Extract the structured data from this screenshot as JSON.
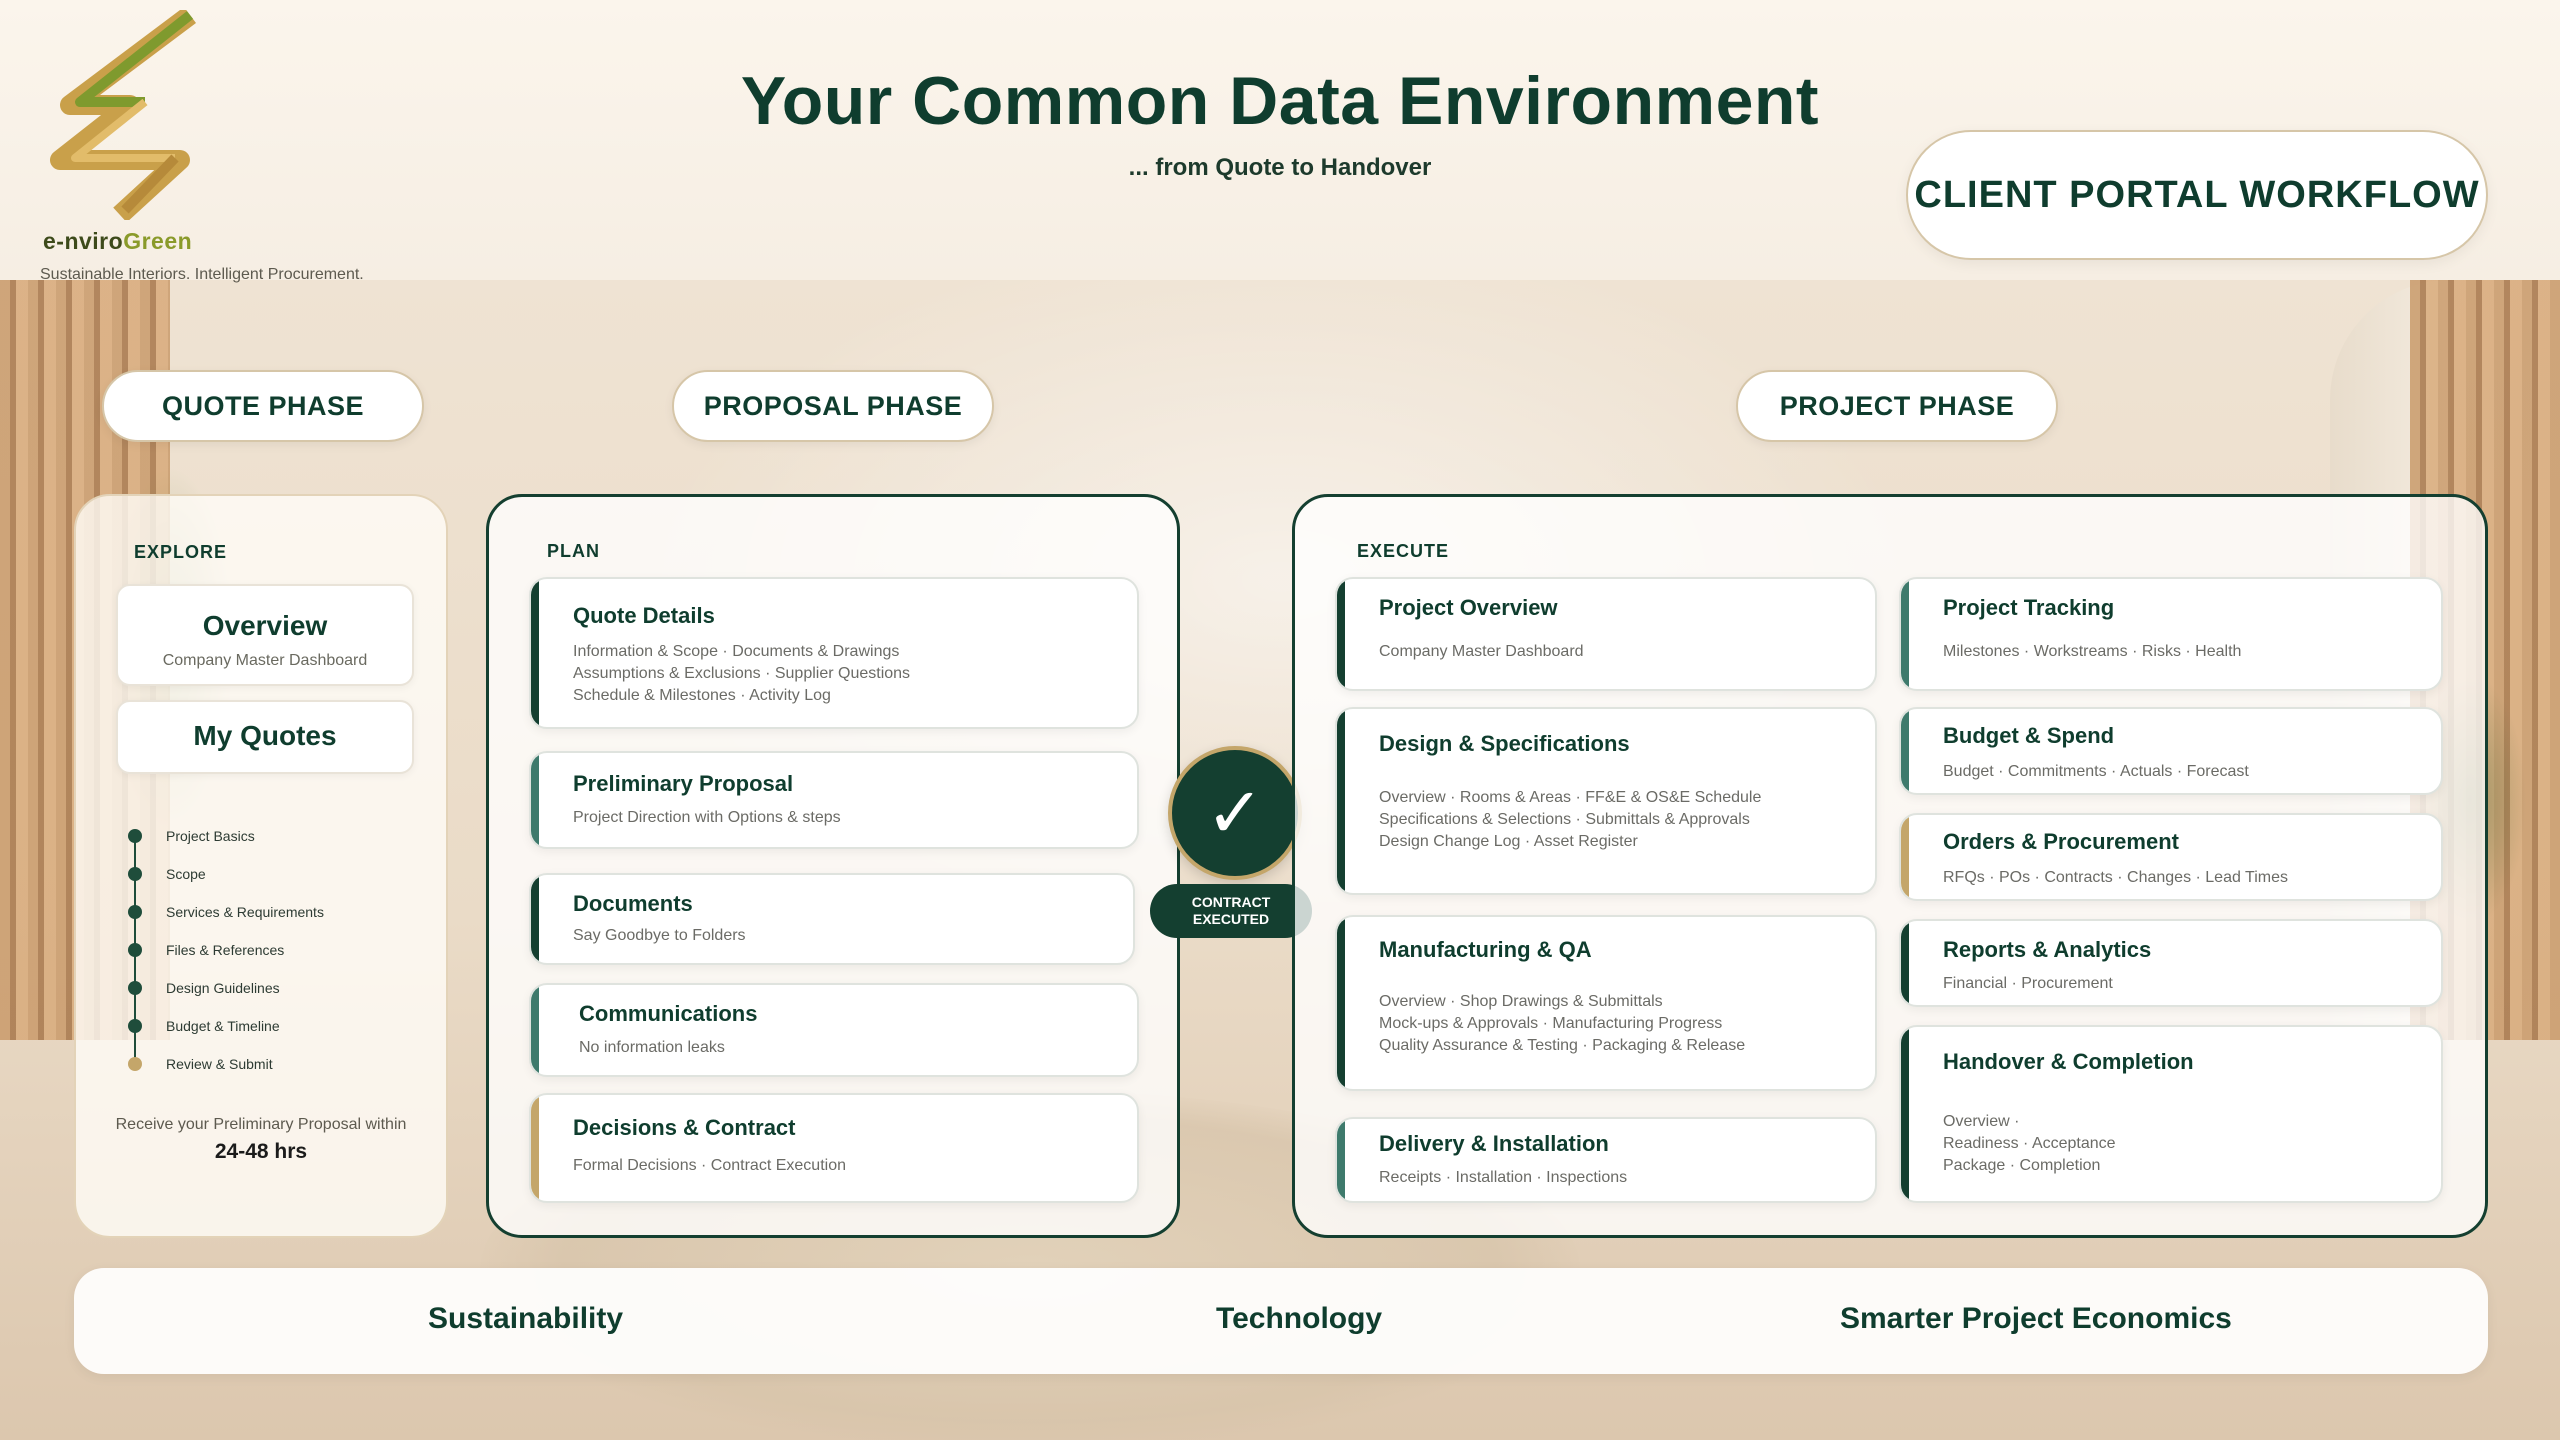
{
  "brand": {
    "name_part1": "e-nviro",
    "name_part2": "Green",
    "tagline": "Sustainable Interiors. Intelligent Procurement.",
    "logo_icon": "ribbon-z-logo-icon"
  },
  "header": {
    "title": "Your Common Data Environment",
    "subtitle": "... from Quote to Handover",
    "portal_button": "CLIENT PORTAL WORKFLOW"
  },
  "phases": {
    "quote": "QUOTE PHASE",
    "proposal": "PROPOSAL PHASE",
    "project": "PROJECT PHASE"
  },
  "explore": {
    "label": "EXPLORE",
    "overview_title": "Overview",
    "overview_sub": "Company Master Dashboard",
    "my_quotes": "My Quotes",
    "steps": [
      "Project Basics",
      "Scope",
      "Services & Requirements",
      "Files & References",
      "Design Guidelines",
      "Budget & Timeline",
      "Review & Submit"
    ],
    "receive_text": "Receive your Preliminary Proposal within",
    "receive_hrs": "24-48 hrs"
  },
  "plan": {
    "label": "PLAN",
    "cards": [
      {
        "title": "Quote Details",
        "desc": "Information & Scope  ·  Documents & Drawings\nAssumptions & Exclusions  ·  Supplier Questions\nSchedule & Milestones  ·  Activity Log"
      },
      {
        "title": "Preliminary Proposal",
        "desc": "Project Direction with Options & steps"
      },
      {
        "title": "Documents",
        "desc": "Say Goodbye to Folders"
      },
      {
        "title": "Communications",
        "desc": "No information leaks"
      },
      {
        "title": "Decisions & Contract",
        "desc": "Formal Decisions  ·  Contract Execution"
      }
    ]
  },
  "contract": {
    "check": "✓",
    "label": "CONTRACT\nEXECUTED"
  },
  "execute": {
    "label": "EXECUTE",
    "left_cards": [
      {
        "title": "Project Overview",
        "desc": "Company Master Dashboard"
      },
      {
        "title": "Design & Specifications",
        "desc": "Overview  ·  Rooms & Areas  ·  FF&E & OS&E Schedule\nSpecifications & Selections  ·  Submittals & Approvals\nDesign Change Log  ·  Asset Register"
      },
      {
        "title": "Manufacturing & QA",
        "desc": "Overview  ·  Shop Drawings & Submittals\nMock-ups & Approvals  ·  Manufacturing Progress\nQuality Assurance & Testing  ·  Packaging & Release"
      },
      {
        "title": "Delivery & Installation",
        "desc": "Receipts  ·  Installation  ·  Inspections"
      }
    ],
    "right_cards": [
      {
        "title": "Project Tracking",
        "desc": "Milestones  ·  Workstreams  ·  Risks  ·  Health"
      },
      {
        "title": "Budget & Spend",
        "desc": "Budget  ·  Commitments  ·  Actuals  ·  Forecast"
      },
      {
        "title": "Orders & Procurement",
        "desc": "RFQs  ·  POs  ·  Contracts  ·  Changes  ·  Lead Times"
      },
      {
        "title": "Reports & Analytics",
        "desc": "Financial  ·  Procurement"
      },
      {
        "title": "Handover & Completion",
        "desc": "Overview  ·\nReadiness  ·  Acceptance\nPackage  ·  Completion"
      }
    ]
  },
  "footer": {
    "items": [
      "Sustainability",
      "Technology",
      "Smarter Project Economics"
    ]
  },
  "colors": {
    "primary": "#0f3d2e",
    "teal_accent": "#3e7a6c",
    "gold_accent": "#c4a66a"
  }
}
